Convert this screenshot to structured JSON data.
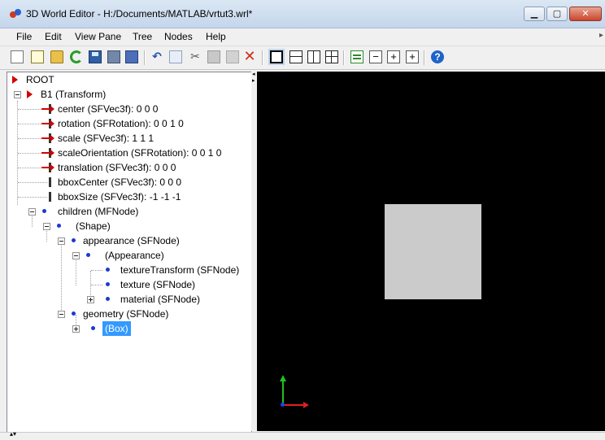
{
  "window": {
    "title": "3D World Editor - H:/Documents/MATLAB/vrtut3.wrl*",
    "buttons": [
      {
        "name": "minimize-button",
        "glyph": "▁"
      },
      {
        "name": "maximize-button",
        "glyph": "▢"
      },
      {
        "name": "close-button",
        "glyph": "✕"
      }
    ]
  },
  "menu": [
    "File",
    "Edit",
    "View Pane",
    "Tree",
    "Nodes",
    "Help"
  ],
  "toolbar": {
    "icons": [
      "new-icon",
      "new-from-template-icon",
      "open-icon",
      "reload-icon",
      "save-icon",
      "save-as-icon",
      "export-icon",
      "undo-icon",
      "copy-icon",
      "cut-icon",
      "paste-icon",
      "paste-special-icon",
      "delete-icon",
      "single-view-icon",
      "split-horizontal-icon",
      "split-vertical-icon",
      "quad-view-icon",
      "show-text-icon",
      "collapse-icon",
      "expand-icon",
      "expand-all-icon",
      "help-icon"
    ]
  },
  "tree": {
    "items": [
      {
        "label": "ROOT"
      },
      {
        "label": "B1 (Transform)"
      },
      {
        "label": "center (SFVec3f): 0 0 0"
      },
      {
        "label": "rotation (SFRotation): 0 0 1 0"
      },
      {
        "label": "scale (SFVec3f): 1 1 1"
      },
      {
        "label": "scaleOrientation (SFRotation): 0 0 1 0"
      },
      {
        "label": "translation (SFVec3f): 0 0 0"
      },
      {
        "label": "bboxCenter (SFVec3f): 0 0 0"
      },
      {
        "label": "bboxSize (SFVec3f): -1 -1 -1"
      },
      {
        "label": "children (MFNode)"
      },
      {
        "label": "(Shape)"
      },
      {
        "label": "appearance (SFNode)"
      },
      {
        "label": "(Appearance)"
      },
      {
        "label": "textureTransform (SFNode)"
      },
      {
        "label": "texture (SFNode)"
      },
      {
        "label": "material (SFNode)"
      },
      {
        "label": "geometry (SFNode)"
      },
      {
        "label": "(Box)"
      }
    ],
    "selected": "(Box)"
  },
  "viewport": {
    "background": "#000000",
    "object_color": "#cbcbcb"
  },
  "colors": {
    "selection": "#3399ff",
    "node_dot": "#1a3ad0",
    "exposed_field": "#d40000"
  }
}
